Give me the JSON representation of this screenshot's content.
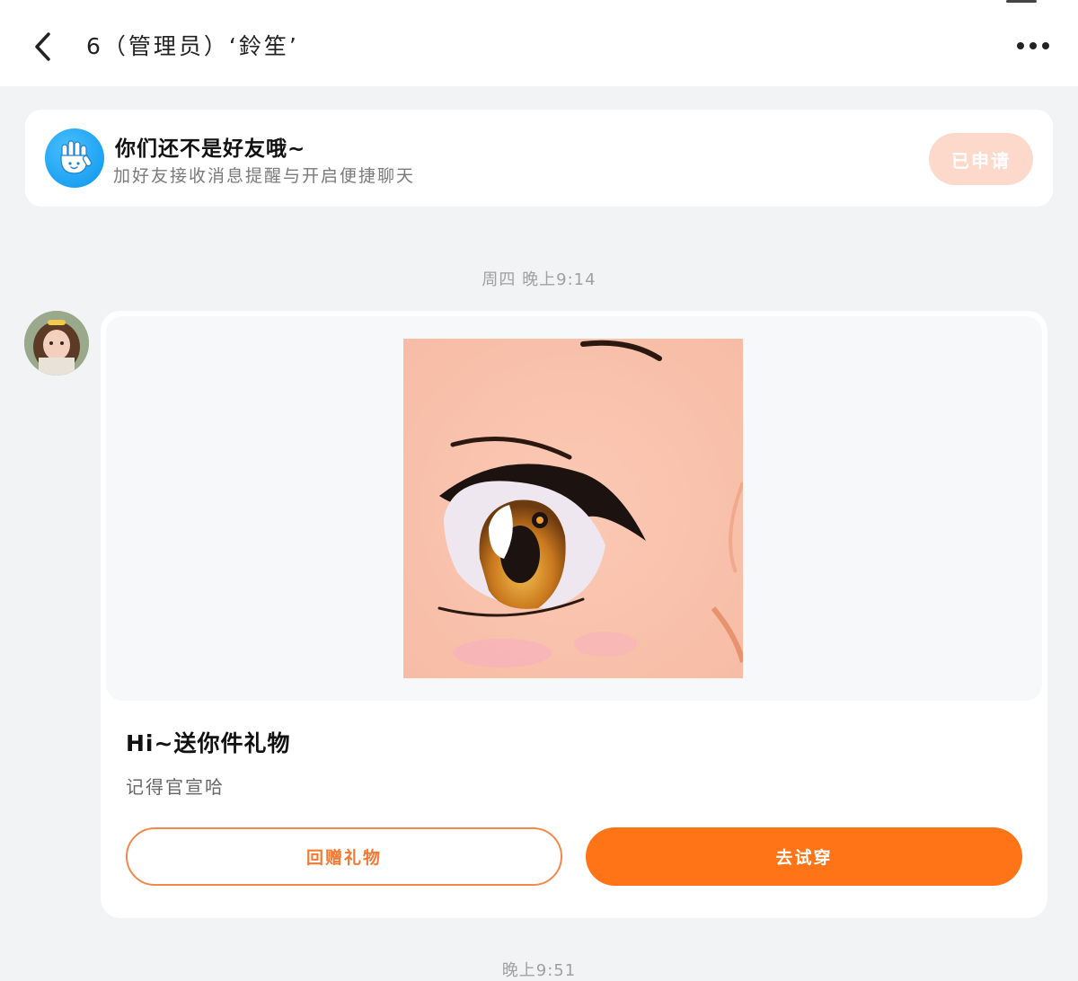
{
  "header": {
    "title": "6（管理员）‘鈴笙’",
    "back_icon": "chevron-left-icon",
    "more_icon": "more-horizontal-icon"
  },
  "friend_banner": {
    "icon": "waving-hand-icon",
    "title": "你们还不是好友哦~",
    "subtitle": "加好友接收消息提醒与开启便捷聊天",
    "button_label": "已申请"
  },
  "messages": [
    {
      "timestamp": "周四 晚上9:14",
      "type": "gift",
      "gift_title": "Hi~送你件礼物",
      "gift_subtitle": "记得官宣哈",
      "return_gift_label": "回赠礼物",
      "try_on_label": "去试穿"
    }
  ],
  "next_timestamp": "晚上9:51",
  "colors": {
    "accent": "#ff7417",
    "accent_light": "#fdd9cc",
    "background": "#f2f3f5",
    "card": "#ffffff"
  }
}
